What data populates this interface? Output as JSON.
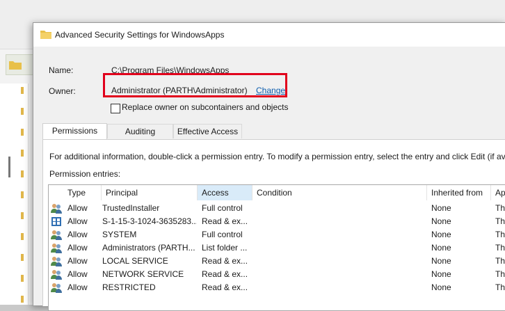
{
  "dialog": {
    "title": "Advanced Security Settings for WindowsApps",
    "name_label": "Name:",
    "name_value": "C:\\Program Files\\WindowsApps",
    "owner_label": "Owner:",
    "owner_value": "Administrator (PARTH\\Administrator)",
    "change_link": "Change",
    "replace_owner_checkbox": "Replace owner on subcontainers and objects",
    "replace_owner_checked": false
  },
  "tabs": [
    {
      "label": "Permissions",
      "active": true
    },
    {
      "label": "Auditing",
      "active": false
    },
    {
      "label": "Effective Access",
      "active": false
    }
  ],
  "panel": {
    "info_text": "For additional information, double-click a permission entry. To modify a permission entry, select the entry and click Edit (if av",
    "entries_label": "Permission entries:"
  },
  "columns": [
    "Type",
    "Principal",
    "Access",
    "Condition",
    "Inherited from",
    "Ap"
  ],
  "rows": [
    {
      "icon": "users-icon",
      "type": "Allow",
      "principal": "TrustedInstaller",
      "access": "Full control",
      "condition": "",
      "inherited": "None",
      "applies": "Th"
    },
    {
      "icon": "app-package-icon",
      "type": "Allow",
      "principal": "S-1-15-3-1024-3635283...",
      "access": "Read & ex...",
      "condition": "",
      "inherited": "None",
      "applies": "Th"
    },
    {
      "icon": "users-icon",
      "type": "Allow",
      "principal": "SYSTEM",
      "access": "Full control",
      "condition": "",
      "inherited": "None",
      "applies": "Th"
    },
    {
      "icon": "users-icon",
      "type": "Allow",
      "principal": "Administrators (PARTH...",
      "access": "List folder ...",
      "condition": "",
      "inherited": "None",
      "applies": "Th"
    },
    {
      "icon": "users-icon",
      "type": "Allow",
      "principal": "LOCAL SERVICE",
      "access": "Read & ex...",
      "condition": "",
      "inherited": "None",
      "applies": "Th"
    },
    {
      "icon": "users-icon",
      "type": "Allow",
      "principal": "NETWORK SERVICE",
      "access": "Read & ex...",
      "condition": "",
      "inherited": "None",
      "applies": "Th"
    },
    {
      "icon": "users-icon",
      "type": "Allow",
      "principal": "RESTRICTED",
      "access": "Read & ex...",
      "condition": "",
      "inherited": "None",
      "applies": "Th"
    }
  ],
  "colors": {
    "highlight_box": "#e1001c",
    "link": "#0b5cad",
    "sorted_header": "#d9ebf9"
  }
}
